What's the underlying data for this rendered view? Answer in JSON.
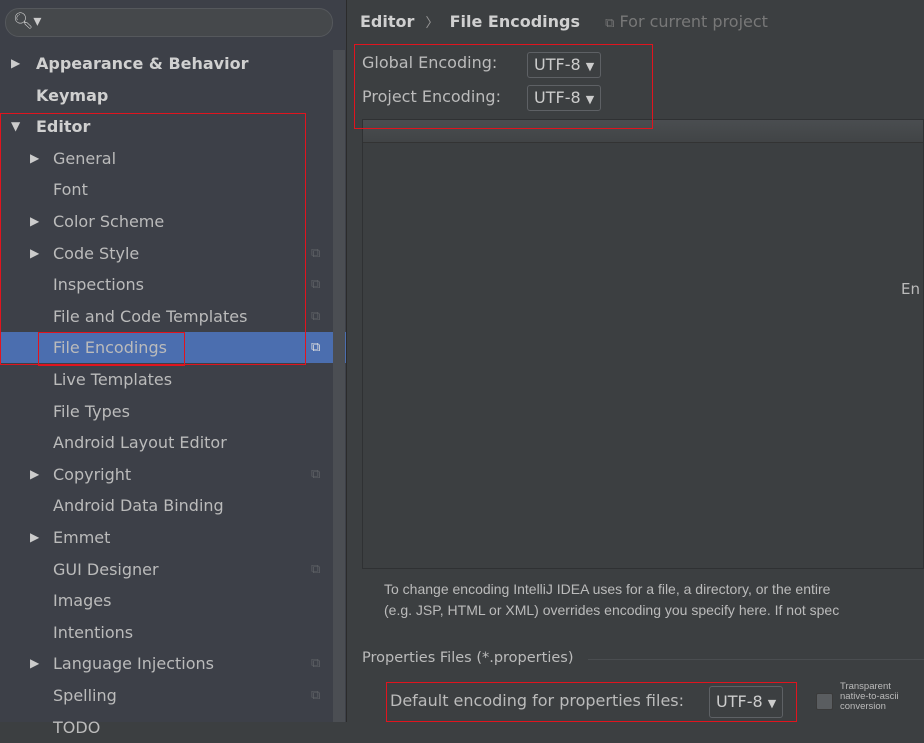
{
  "search": {
    "icon": "search-icon",
    "value": ""
  },
  "sidebar": {
    "items": [
      {
        "label": "Appearance & Behavior",
        "level": 0,
        "expandable": true,
        "expanded": false,
        "bold": true
      },
      {
        "label": "Keymap",
        "level": 0,
        "expandable": false,
        "bold": true
      },
      {
        "label": "Editor",
        "level": 0,
        "expandable": true,
        "expanded": true,
        "bold": true
      },
      {
        "label": "General",
        "level": 1,
        "expandable": true
      },
      {
        "label": "Font",
        "level": 1
      },
      {
        "label": "Color Scheme",
        "level": 1,
        "expandable": true
      },
      {
        "label": "Code Style",
        "level": 1,
        "expandable": true,
        "project": true
      },
      {
        "label": "Inspections",
        "level": 1,
        "project": true
      },
      {
        "label": "File and Code Templates",
        "level": 1,
        "project": true
      },
      {
        "label": "File Encodings",
        "level": 1,
        "project": true,
        "selected": true
      },
      {
        "label": "Live Templates",
        "level": 1
      },
      {
        "label": "File Types",
        "level": 1
      },
      {
        "label": "Android Layout Editor",
        "level": 1
      },
      {
        "label": "Copyright",
        "level": 1,
        "expandable": true,
        "project": true
      },
      {
        "label": "Android Data Binding",
        "level": 1
      },
      {
        "label": "Emmet",
        "level": 1,
        "expandable": true
      },
      {
        "label": "GUI Designer",
        "level": 1,
        "project": true
      },
      {
        "label": "Images",
        "level": 1
      },
      {
        "label": "Intentions",
        "level": 1
      },
      {
        "label": "Language Injections",
        "level": 1,
        "expandable": true,
        "project": true
      },
      {
        "label": "Spelling",
        "level": 1,
        "project": true
      },
      {
        "label": "TODO",
        "level": 1
      }
    ]
  },
  "breadcrumb": {
    "parent": "Editor",
    "separator": "〉",
    "current": "File Encodings",
    "scope": "For current project"
  },
  "global_encoding": {
    "label": "Global Encoding:",
    "value": "UTF-8"
  },
  "project_encoding": {
    "label": "Project Encoding:",
    "value": "UTF-8"
  },
  "table": {
    "empty_text": "En"
  },
  "note": {
    "line1": "To change encoding IntelliJ IDEA uses for a file, a directory, or the entire",
    "line2": "(e.g. JSP, HTML or XML) overrides encoding you specify here. If not spec"
  },
  "properties": {
    "section": "Properties Files (*.properties)",
    "label": "Default encoding for properties files:",
    "value": "UTF-8",
    "transparent_label": "Transparent native-to-ascii conversion",
    "transparent_checked": false
  },
  "colors": {
    "selection": "#4b6eaf",
    "highlight_box": "#e0141e"
  }
}
